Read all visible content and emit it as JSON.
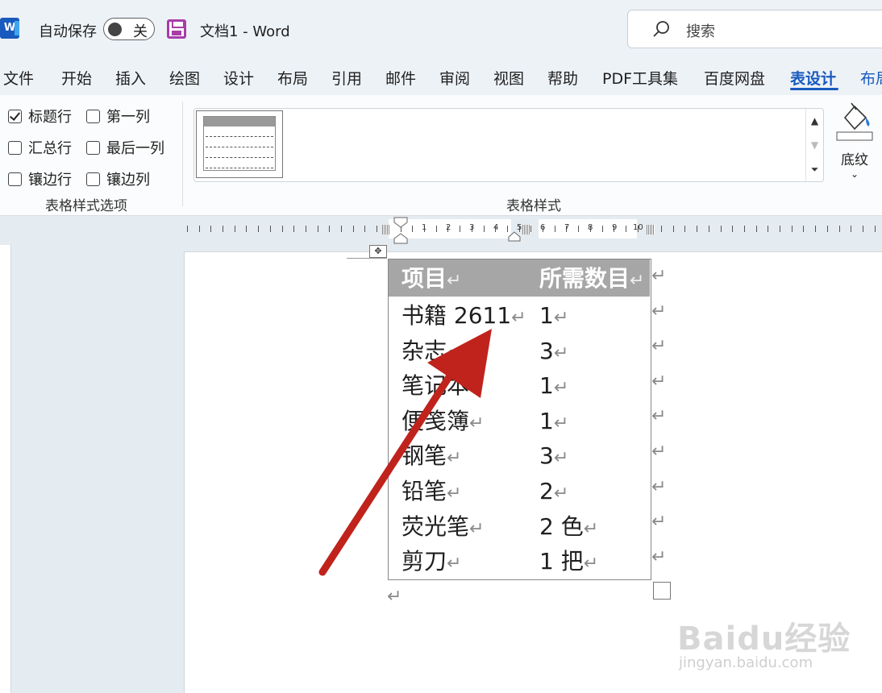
{
  "titlebar": {
    "logo": "W",
    "autosave_label": "自动保存",
    "autosave_state": "关",
    "doc_title": "文档1  -  Word",
    "search_placeholder": "搜索"
  },
  "tabs": [
    "文件",
    "开始",
    "插入",
    "绘图",
    "设计",
    "布局",
    "引用",
    "邮件",
    "审阅",
    "视图",
    "帮助",
    "PDF工具集",
    "百度网盘",
    "表设计",
    "布局"
  ],
  "active_tab": "表设计",
  "ribbon": {
    "options": {
      "header_row": "标题行",
      "first_column": "第一列",
      "total_row": "汇总行",
      "last_column": "最后一列",
      "banded_rows": "镶边行",
      "banded_columns": "镶边列",
      "group_label": "表格样式选项"
    },
    "checked": {
      "header_row": true,
      "first_column": false,
      "total_row": false,
      "last_column": false,
      "banded_rows": false,
      "banded_columns": false
    },
    "styles_group_label": "表格样式",
    "shading_label": "底纹"
  },
  "ruler": {
    "numbers": [
      "1",
      "2",
      "3",
      "4",
      "5",
      "6",
      "7",
      "8",
      "9",
      "10"
    ]
  },
  "table": {
    "headers": [
      "项目",
      "所需数目"
    ],
    "rows": [
      [
        "书籍  2611",
        "1"
      ],
      [
        "杂志",
        "3"
      ],
      [
        "笔记本",
        "1"
      ],
      [
        "便笺簿",
        "1"
      ],
      [
        "钢笔",
        "3"
      ],
      [
        "铅笔",
        "2"
      ],
      [
        "荧光笔",
        "2  色"
      ],
      [
        "剪刀",
        "1  把"
      ]
    ]
  },
  "para_mark": "↵",
  "annotation_color": "#c0231c",
  "watermark": {
    "main": "Baidu经验",
    "sub": "jingyan.baidu.com"
  }
}
